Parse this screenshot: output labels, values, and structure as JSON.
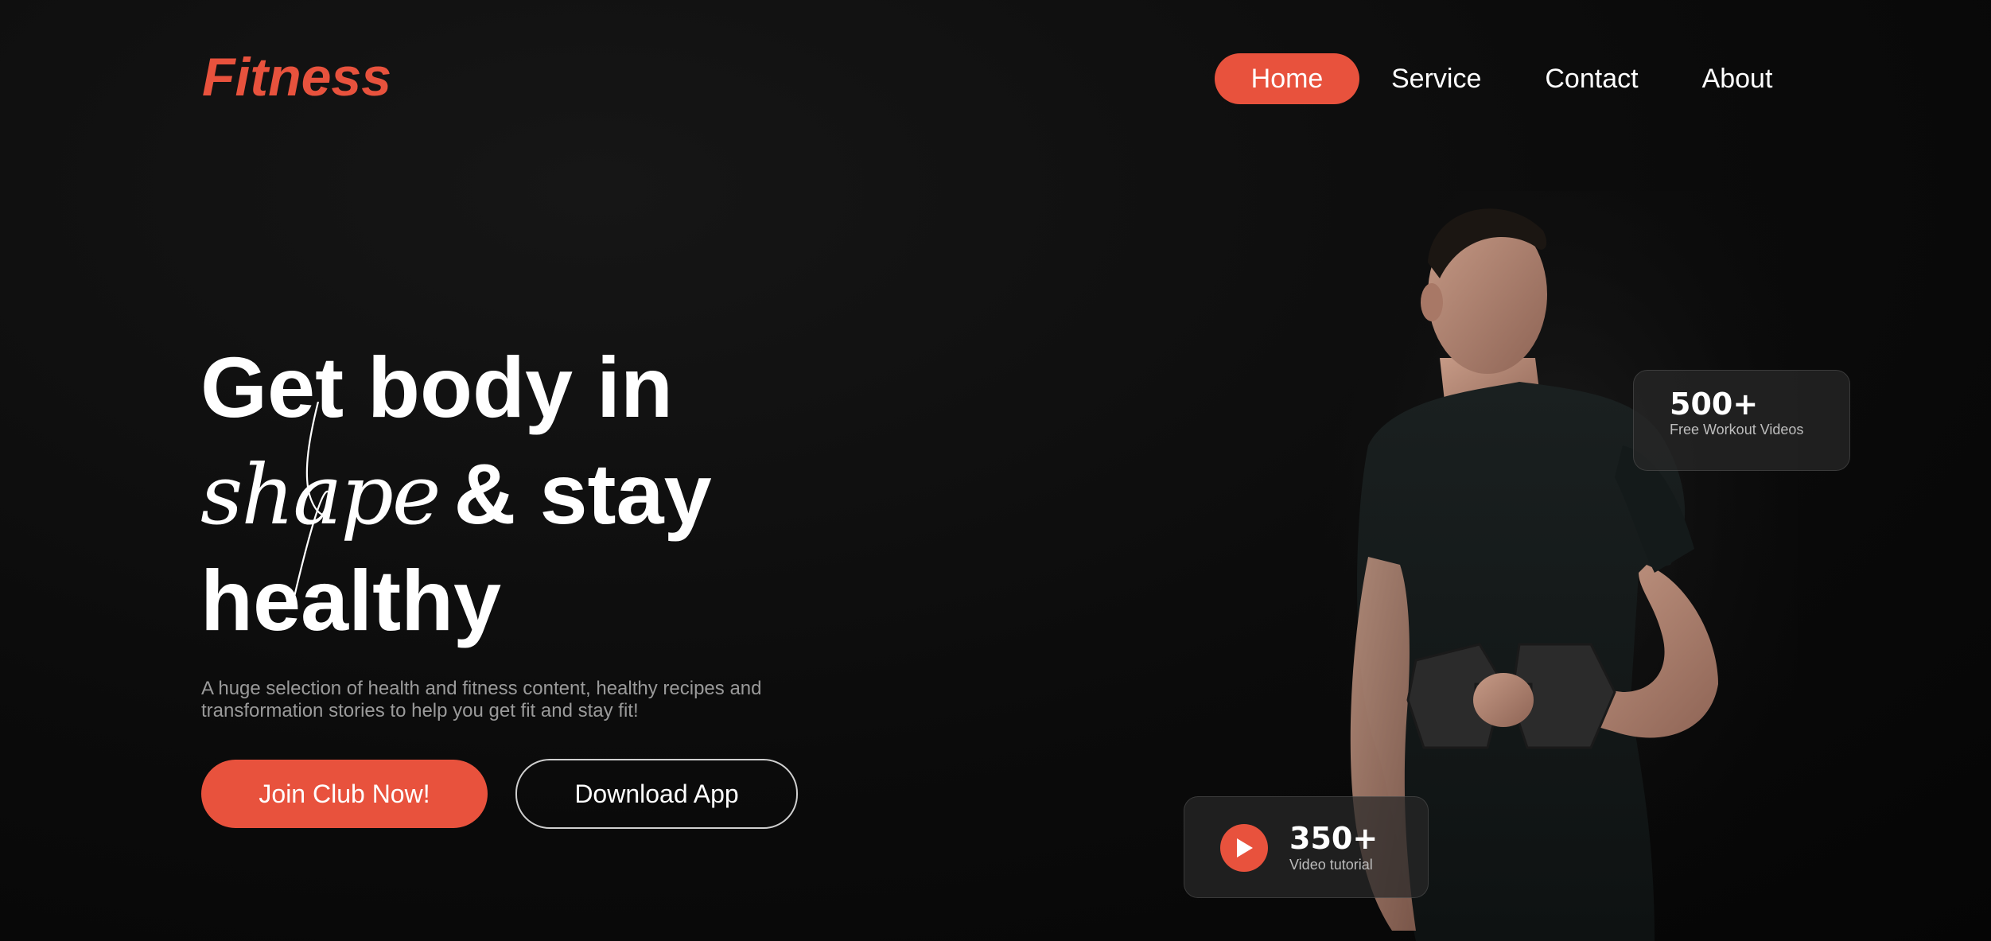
{
  "brand": {
    "logo_text": "Fitness",
    "accent_color": "#e8523d"
  },
  "nav": {
    "items": [
      {
        "label": "Home",
        "active": true
      },
      {
        "label": "Service",
        "active": false
      },
      {
        "label": "Contact",
        "active": false
      },
      {
        "label": "About",
        "active": false
      }
    ]
  },
  "hero": {
    "headline_line1": "Get body in",
    "headline_script_word": "shape",
    "headline_line2_rest": "& stay",
    "headline_line3": "healthy",
    "subtitle": "A huge selection of health and fitness content, healthy recipes and transformation stories to help you get fit and stay fit!",
    "primary_button": "Join Club Now!",
    "secondary_button": "Download App"
  },
  "stats": {
    "workouts": {
      "number": "500+",
      "label": "Free Workout Videos"
    },
    "tutorials": {
      "number": "350+",
      "label": "Video tutorial",
      "icon": "play-icon"
    }
  },
  "figure": {
    "icon": "man-with-dumbbell-image"
  }
}
